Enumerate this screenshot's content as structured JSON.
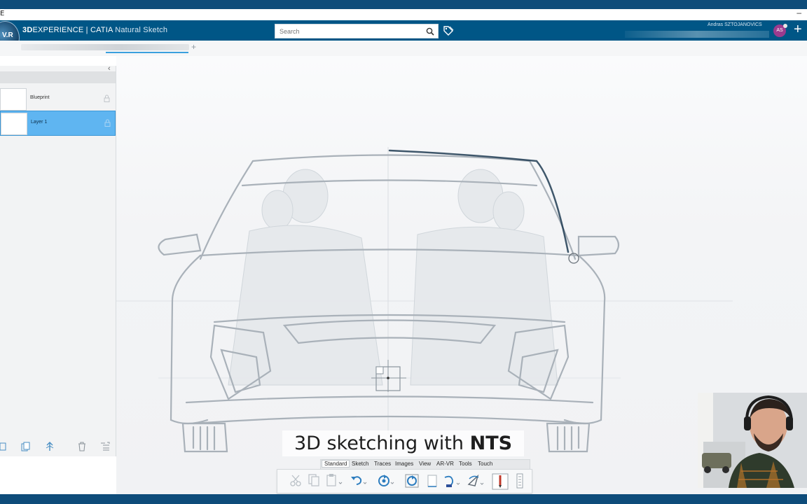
{
  "app": {
    "brand_prefix": "3D",
    "brand_main": "EXPERIENCE | CATIA",
    "app_name": "Natural Sketch",
    "compass_label": "V.R"
  },
  "window": {
    "left_glyph": "E",
    "minimize": "–"
  },
  "search": {
    "placeholder": "Search"
  },
  "user": {
    "name": "Andras SZTOJANOVICS",
    "initials": "AS"
  },
  "tabs": {
    "add_label": "+"
  },
  "layers_panel": {
    "collapse_label": "‹",
    "layers": [
      {
        "name": "Blueprint",
        "selected": false
      },
      {
        "name": "Layer 1",
        "selected": true
      }
    ]
  },
  "caption": {
    "text_plain": "3D sketching with ",
    "text_bold": "NTS"
  },
  "bottom_tabs": [
    "Standard",
    "Sketch",
    "Traces",
    "Images",
    "View",
    "AR-VR",
    "Tools",
    "Touch"
  ],
  "active_bottom_tab": "Standard",
  "toolbar_icons": [
    "cut-icon",
    "copy-icon",
    "paste-icon",
    "undo-icon",
    "update-icon",
    "refresh-icon",
    "sheet-icon",
    "stroke-icon",
    "curve-icon",
    "pen-icon",
    "ruler-icon"
  ],
  "colors": {
    "accent": "#005686",
    "selection": "#5fb5f1",
    "frame": "#0e4c7a"
  }
}
